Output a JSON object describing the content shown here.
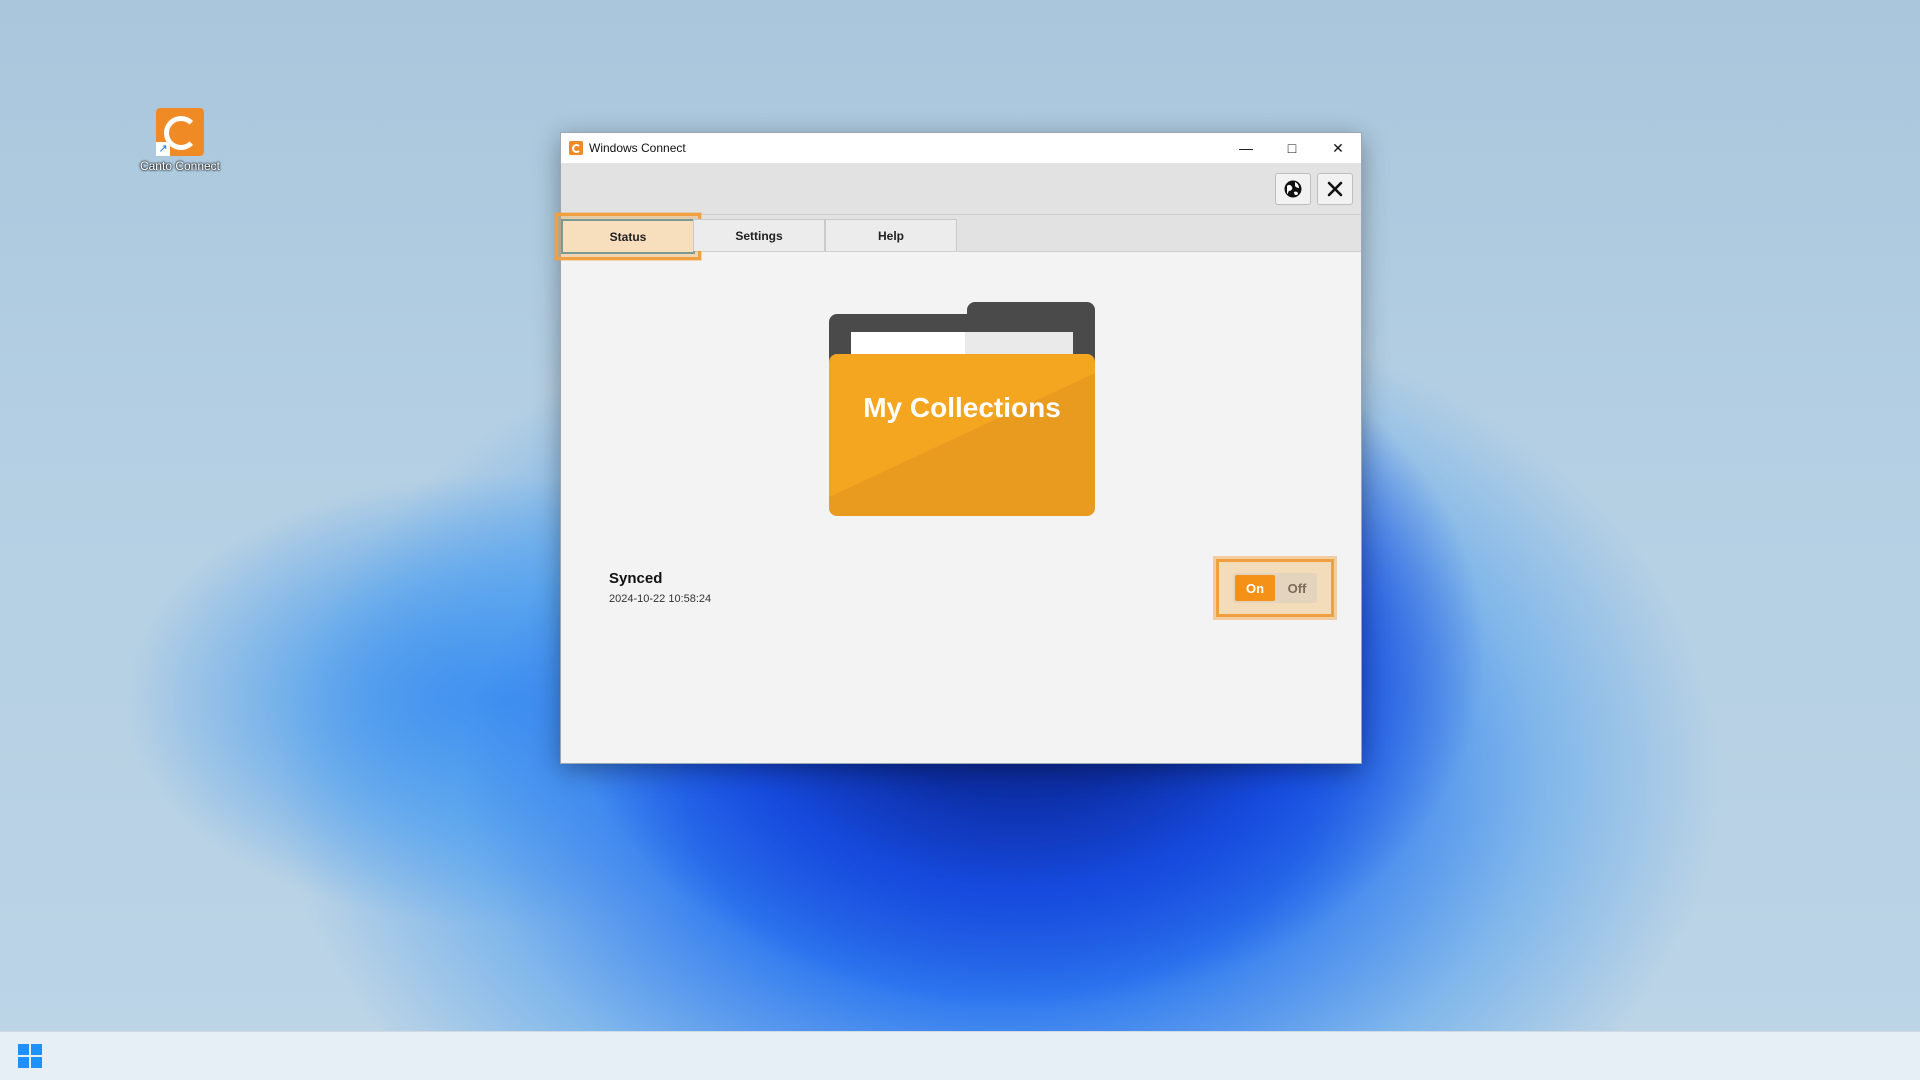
{
  "desktop": {
    "icon_label": "Canto Connect"
  },
  "window": {
    "title": "Windows Connect",
    "controls": {
      "minimize": "—",
      "maximize": "□",
      "close": "✕"
    }
  },
  "tabs": [
    {
      "label": "Status",
      "active": true
    },
    {
      "label": "Settings",
      "active": false
    },
    {
      "label": "Help",
      "active": false
    }
  ],
  "folder": {
    "label": "My Collections"
  },
  "status": {
    "title": "Synced",
    "timestamp": "2024-10-22 10:58:24"
  },
  "toggle": {
    "on_label": "On",
    "off_label": "Off",
    "state": "on"
  },
  "colors": {
    "accent": "#f39216",
    "folder": "#f4a620",
    "highlight": "#f0a040"
  }
}
